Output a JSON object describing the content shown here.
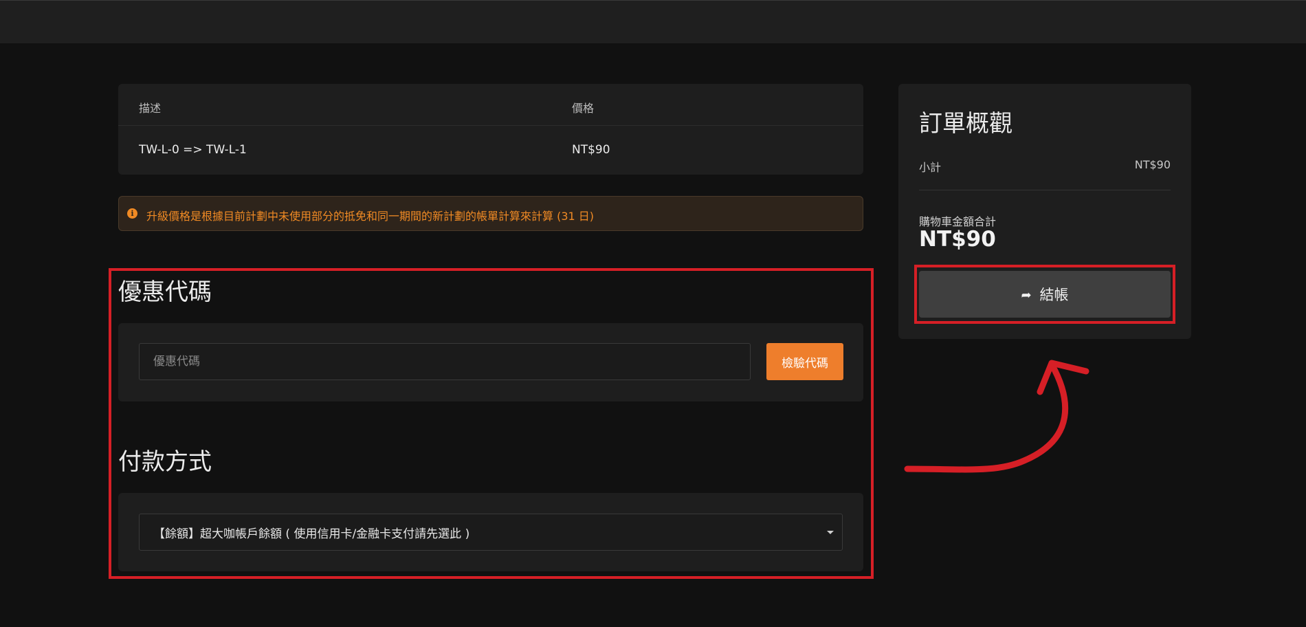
{
  "cart": {
    "headers": {
      "description": "描述",
      "price": "價格"
    },
    "rows": [
      {
        "description": "TW-L-0 => TW-L-1",
        "price": "NT$90"
      }
    ]
  },
  "notice": {
    "icon": "info-circle-icon",
    "text": "升級價格是根據目前計劃中未使用部分的抵免和同一期間的新計劃的帳單計算來計算 (31 日)"
  },
  "coupon": {
    "title": "優惠代碼",
    "placeholder": "優惠代碼",
    "value": "",
    "button_label": "檢驗代碼"
  },
  "payment": {
    "title": "付款方式",
    "selected": "【餘額】超大咖帳戶餘額 ( 使用信用卡/金融卡支付請先選此 )"
  },
  "summary": {
    "title": "訂單概觀",
    "subtotal_label": "小計",
    "subtotal_value": "NT$90",
    "total_label": "購物車金額合計",
    "total_value": "NT$90",
    "checkout_label": "結帳",
    "checkout_icon": "share-arrow-icon"
  },
  "colors": {
    "accent_orange": "#ee7e2c",
    "annotation_red": "#d61f26",
    "background": "#111111",
    "panel": "#1e1e1e"
  }
}
